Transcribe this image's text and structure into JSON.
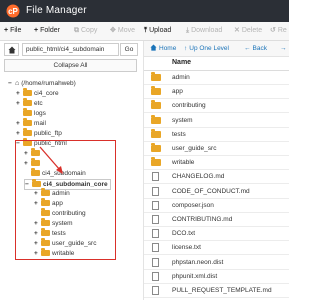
{
  "title_bar": {
    "title": "File Manager"
  },
  "toolbar": {
    "items": [
      {
        "label": "File",
        "icon": "plus-icon",
        "enabled": true
      },
      {
        "label": "Folder",
        "icon": "plus-icon",
        "enabled": true
      },
      {
        "label": "Copy",
        "icon": "copy-icon",
        "enabled": false
      },
      {
        "label": "Move",
        "icon": "move-icon",
        "enabled": false
      },
      {
        "label": "Upload",
        "icon": "upload-icon",
        "enabled": true
      },
      {
        "label": "Download",
        "icon": "download-icon",
        "enabled": false
      },
      {
        "label": "Delete",
        "icon": "delete-icon",
        "enabled": false
      },
      {
        "label": "Re",
        "icon": "restore-icon",
        "enabled": false
      }
    ]
  },
  "left_pane": {
    "path_value": "public_html/ci4_subdomain",
    "go_label": "Go",
    "collapse_label": "Collapse All",
    "tree": [
      {
        "label": "(/home/rumahweb)",
        "toggle": "−",
        "icon": "home-icon",
        "bold": false,
        "selected": false
      },
      {
        "label": "ci4_core",
        "toggle": "+",
        "icon": "folder-icon",
        "bold": false,
        "selected": false
      },
      {
        "label": "etc",
        "toggle": "+",
        "icon": "folder-icon",
        "bold": false,
        "selected": false
      },
      {
        "label": "logs",
        "toggle": "",
        "icon": "folder-icon",
        "bold": false,
        "selected": false
      },
      {
        "label": "mail",
        "toggle": "+",
        "icon": "folder-icon",
        "bold": false,
        "selected": false
      },
      {
        "label": "public_ftp",
        "toggle": "+",
        "icon": "folder-icon",
        "bold": false,
        "selected": false
      },
      {
        "label": "public_html",
        "toggle": "−",
        "icon": "folder-icon",
        "bold": false,
        "selected": false
      },
      {
        "label": "",
        "toggle": "+",
        "icon": "folder-icon",
        "bold": false,
        "selected": false
      },
      {
        "label": "",
        "toggle": "+",
        "icon": "folder-icon",
        "bold": false,
        "selected": false
      },
      {
        "label": "ci4_subdomain",
        "toggle": "",
        "icon": "folder-icon",
        "bold": false,
        "selected": false
      },
      {
        "label": "ci4_subdomain_core",
        "toggle": "−",
        "icon": "folder-icon",
        "bold": true,
        "selected": true
      },
      {
        "label": "admin",
        "toggle": "+",
        "icon": "folder-icon",
        "bold": false,
        "selected": false
      },
      {
        "label": "app",
        "toggle": "+",
        "icon": "folder-icon",
        "bold": false,
        "selected": false
      },
      {
        "label": "contributing",
        "toggle": "",
        "icon": "folder-icon",
        "bold": false,
        "selected": false
      },
      {
        "label": "system",
        "toggle": "+",
        "icon": "folder-icon",
        "bold": false,
        "selected": false
      },
      {
        "label": "tests",
        "toggle": "+",
        "icon": "folder-icon",
        "bold": false,
        "selected": false
      },
      {
        "label": "user_guide_src",
        "toggle": "+",
        "icon": "folder-icon",
        "bold": false,
        "selected": false
      },
      {
        "label": "writable",
        "toggle": "+",
        "icon": "folder-icon",
        "bold": false,
        "selected": false
      }
    ]
  },
  "right_pane": {
    "nav": [
      {
        "label": "Home",
        "icon": "home-icon"
      },
      {
        "label": "Up One Level",
        "icon": "up-arrow-icon"
      },
      {
        "label": "Back",
        "icon": "back-arrow-icon"
      },
      {
        "label": "→",
        "icon": "forward-arrow-icon"
      }
    ],
    "column_name": "Name",
    "files": [
      {
        "name": "admin",
        "type": "folder"
      },
      {
        "name": "app",
        "type": "folder"
      },
      {
        "name": "contributing",
        "type": "folder"
      },
      {
        "name": "system",
        "type": "folder"
      },
      {
        "name": "tests",
        "type": "folder"
      },
      {
        "name": "user_guide_src",
        "type": "folder"
      },
      {
        "name": "writable",
        "type": "folder"
      },
      {
        "name": "CHANGELOG.md",
        "type": "file"
      },
      {
        "name": "CODE_OF_CONDUCT.md",
        "type": "file"
      },
      {
        "name": "composer.json",
        "type": "file"
      },
      {
        "name": "CONTRIBUTING.md",
        "type": "file"
      },
      {
        "name": "DCO.txt",
        "type": "file"
      },
      {
        "name": "license.txt",
        "type": "file"
      },
      {
        "name": "phpstan.neon.dist",
        "type": "file"
      },
      {
        "name": "phpunit.xml.dist",
        "type": "file"
      },
      {
        "name": "PULL_REQUEST_TEMPLATE.md",
        "type": "file"
      }
    ]
  },
  "colors": {
    "titlebar": "#2b2f36",
    "accent": "#1a73b8",
    "folder": "#e9a626",
    "highlight": "#d9302a",
    "cpanel_orange": "#ff6c2c"
  }
}
